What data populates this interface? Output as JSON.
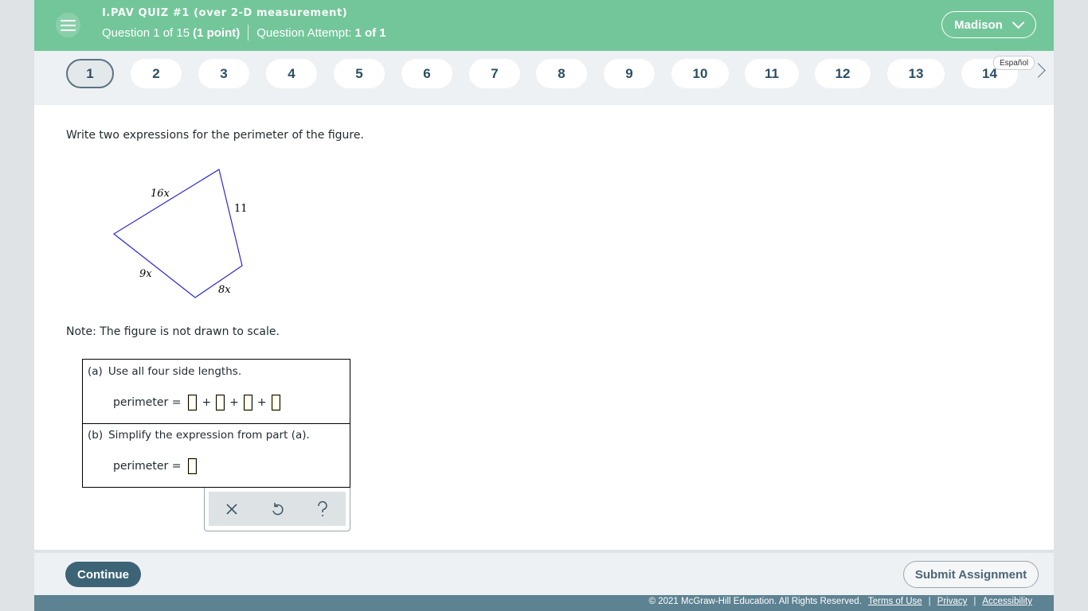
{
  "header": {
    "quiz_title": "I.PAV QUIZ #1 (over 2-D measurement)",
    "question_text": "Question 1 of 15",
    "points": "(1 point)",
    "attempt_label": "Question Attempt:",
    "attempt_value": "1 of 1",
    "user_name": "Madison"
  },
  "nav": {
    "questions": [
      "1",
      "2",
      "3",
      "4",
      "5",
      "6",
      "7",
      "8",
      "9",
      "10",
      "11",
      "12",
      "13",
      "14"
    ],
    "active": "1",
    "language_link": "Español"
  },
  "question": {
    "prompt": "Write two expressions for the perimeter of the figure.",
    "figure_labels": {
      "top": "16x",
      "right": "11",
      "left_bottom": "9x",
      "bottom": "8x"
    },
    "note": "Note: The figure is not drawn to scale.",
    "part_a": {
      "letter": "(a)",
      "instruction": "Use all four side lengths.",
      "eq_label": "perimeter =",
      "plus": "+"
    },
    "part_b": {
      "letter": "(b)",
      "instruction": "Simplify the expression from part (a).",
      "eq_label": "perimeter ="
    }
  },
  "toolbar": {
    "clear_icon": "close-icon",
    "undo_icon": "undo-icon",
    "help_icon": "help-icon"
  },
  "footer": {
    "continue_label": "Continue",
    "submit_label": "Submit Assignment",
    "copyright": "© 2021 McGraw-Hill Education. All Rights Reserved.",
    "terms": "Terms of Use",
    "privacy": "Privacy",
    "accessibility": "Accessibility",
    "separator": "|"
  },
  "colors": {
    "header_bg": "#73c69a",
    "accent_dark": "#3c6476",
    "shape_stroke": "#2a2ad6"
  }
}
